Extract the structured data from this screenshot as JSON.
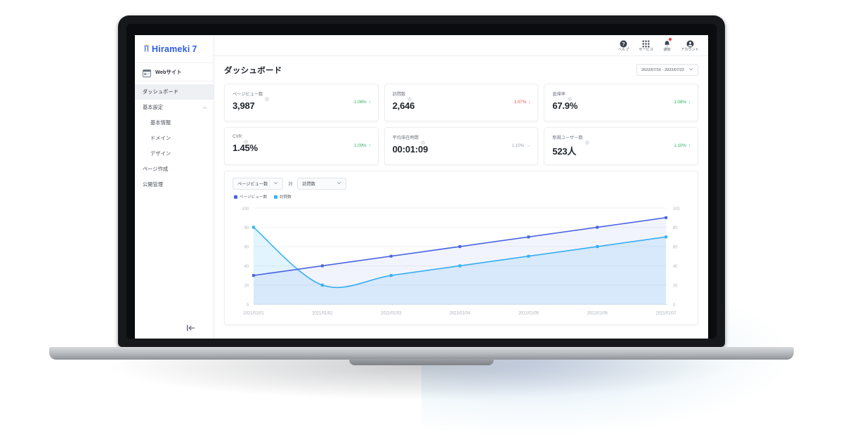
{
  "brand": {
    "name": "Hirameki",
    "version": "7",
    "logo_icon": "hirameki-logo-icon"
  },
  "sidebar": {
    "site_switcher": {
      "label": "Webサイト",
      "icon": "website-icon"
    },
    "items": [
      {
        "label": "ダッシュボード",
        "active": true,
        "sub": false,
        "expandable": false
      },
      {
        "label": "基本設定",
        "active": false,
        "sub": false,
        "expandable": true
      },
      {
        "label": "基本情報",
        "active": false,
        "sub": true,
        "expandable": false
      },
      {
        "label": "ドメイン",
        "active": false,
        "sub": true,
        "expandable": false
      },
      {
        "label": "デザイン",
        "active": false,
        "sub": true,
        "expandable": false
      },
      {
        "label": "ページ作成",
        "active": false,
        "sub": false,
        "expandable": false
      },
      {
        "label": "公開管理",
        "active": false,
        "sub": false,
        "expandable": false
      }
    ],
    "collapse_icon": "collapse-sidebar-icon"
  },
  "topbar": {
    "actions": [
      {
        "label": "ヘルプ",
        "icon": "help-icon",
        "badge": false
      },
      {
        "label": "サービス",
        "icon": "apps-grid-icon",
        "badge": false
      },
      {
        "label": "通知",
        "icon": "bell-icon",
        "badge": true
      },
      {
        "label": "アカウント",
        "icon": "account-icon",
        "badge": false
      }
    ]
  },
  "page": {
    "title": "ダッシュボード",
    "date_range": "2022/07/16 - 2022/07/22"
  },
  "kpis": [
    {
      "label": "ページビュー数",
      "value": "3,987",
      "delta": "1.06%",
      "arrow": "↑",
      "trend": "up"
    },
    {
      "label": "訪問数",
      "value": "2,646",
      "delta": "1.07%",
      "arrow": "↓",
      "trend": "down-bad"
    },
    {
      "label": "直帰率",
      "value": "67.9%",
      "delta": "1.08%",
      "arrow": "↓",
      "trend": "down-good"
    },
    {
      "label": "CVR",
      "value": "1.45%",
      "delta": "1.09%",
      "arrow": "↑",
      "trend": "up"
    },
    {
      "label": "平均滞在時間",
      "value": "00:01:09",
      "delta": "1.10%",
      "arrow": "→",
      "trend": "flat"
    },
    {
      "label": "新規ユーザー数",
      "value": "523人",
      "delta": "1.10%",
      "arrow": "↑",
      "trend": "up"
    }
  ],
  "chart_controls": {
    "metric_a": "ページビュー数",
    "versus_label": "対",
    "metric_b": "訪問数"
  },
  "colors": {
    "series_a": "#4A66E0",
    "series_b": "#35B4F2",
    "accent": "#2C5CE6",
    "positive": "#26b35f",
    "negative": "#e8524c",
    "neutral": "#9aa0a9"
  },
  "chart_data": {
    "type": "line",
    "title": "",
    "xlabel": "",
    "ylabel": "",
    "ylim": [
      0,
      100
    ],
    "y_right_lim": [
      0,
      100
    ],
    "yticks": [
      0,
      20,
      40,
      60,
      80,
      100
    ],
    "y_right_ticks": [
      0,
      20,
      40,
      60,
      80,
      100
    ],
    "grid": true,
    "legend_position": "top-left",
    "categories": [
      "2021/01/01",
      "2021/01/02",
      "2021/01/03",
      "2021/01/04",
      "2021/01/05",
      "2021/01/06",
      "2021/01/07"
    ],
    "series": [
      {
        "name": "ページビュー数",
        "color": "#4A66E0",
        "values": [
          30,
          40,
          50,
          60,
          70,
          80,
          90
        ],
        "area": true
      },
      {
        "name": "訪問数",
        "color": "#35B4F2",
        "values": [
          80,
          20,
          30,
          40,
          50,
          60,
          70
        ],
        "area": true
      }
    ]
  }
}
